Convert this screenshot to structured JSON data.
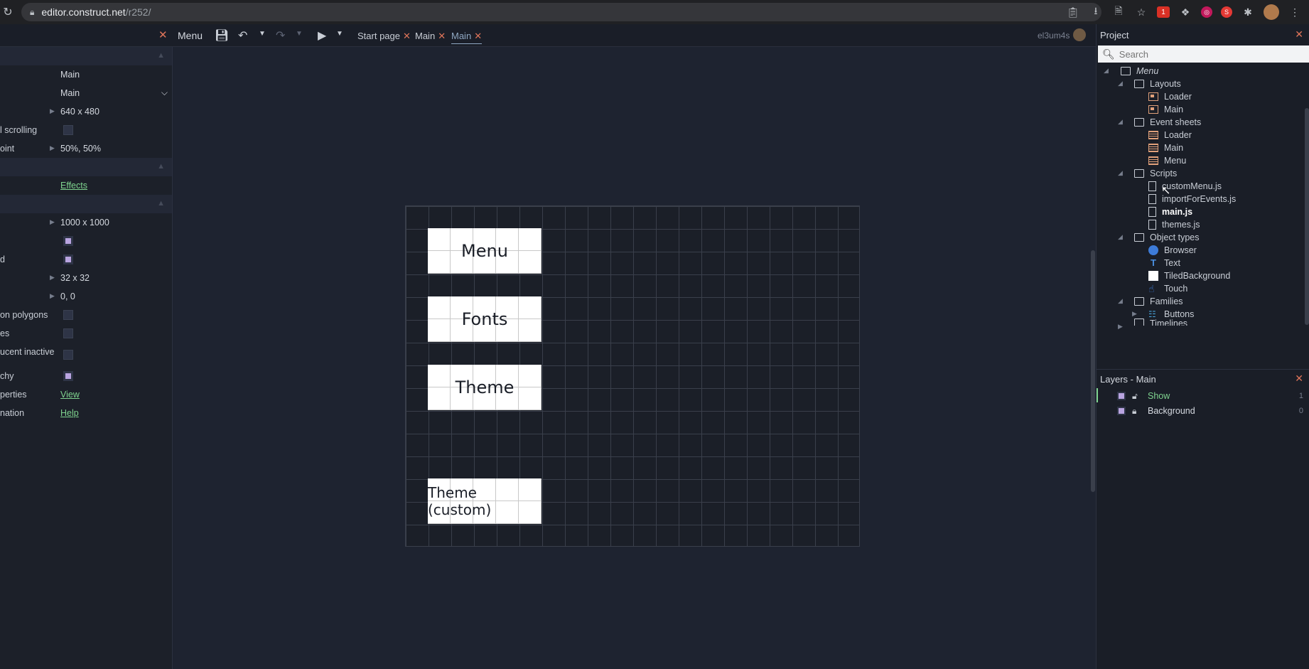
{
  "browser": {
    "url_host": "editor.construct.net",
    "url_path": "/r252/",
    "ext_badge": "1"
  },
  "toolbar": {
    "menu_label": "Menu",
    "tabs": [
      {
        "label": "Start page",
        "active": false
      },
      {
        "label": "Main",
        "active": false
      },
      {
        "label": "Main",
        "active": true
      }
    ],
    "user": "el3um4s"
  },
  "properties": {
    "rows": [
      {
        "label": "",
        "value": "Main"
      },
      {
        "label": "",
        "value": "Main"
      },
      {
        "label": "",
        "value": "640 x 480"
      },
      {
        "label": "l scrolling",
        "value": ""
      },
      {
        "label": "oint",
        "value": "50%, 50%"
      },
      {
        "label": "",
        "value": "Effects"
      },
      {
        "label": "",
        "value": "1000 x 1000"
      },
      {
        "label": "",
        "value": ""
      },
      {
        "label": "d",
        "value": ""
      },
      {
        "label": "",
        "value": "32 x 32"
      },
      {
        "label": "",
        "value": "0, 0"
      },
      {
        "label": "on polygons",
        "value": ""
      },
      {
        "label": "es",
        "value": ""
      },
      {
        "label": "ucent inactive",
        "value": ""
      },
      {
        "label": "chy",
        "value": ""
      },
      {
        "label": "perties",
        "value": "View"
      },
      {
        "label": "nation",
        "value": "Help"
      }
    ]
  },
  "layout_objects": {
    "buttons": [
      "Menu",
      "Fonts",
      "Theme",
      "Theme (custom)"
    ]
  },
  "project": {
    "title": "Project",
    "search_placeholder": "Search",
    "root": "Menu",
    "layouts_folder": "Layouts",
    "layouts": [
      "Loader",
      "Main"
    ],
    "eventsheets_folder": "Event sheets",
    "eventsheets": [
      "Loader",
      "Main",
      "Menu"
    ],
    "scripts_folder": "Scripts",
    "scripts": [
      "customMenu.js",
      "importForEvents.js",
      "main.js",
      "themes.js"
    ],
    "objecttypes_folder": "Object types",
    "objecttypes": [
      "Browser",
      "Text",
      "TiledBackground",
      "Touch"
    ],
    "families_folder": "Families",
    "families": [
      "Buttons"
    ],
    "timelines_folder": "Timelines"
  },
  "layers": {
    "title": "Layers - Main",
    "items": [
      {
        "name": "Show",
        "index": "1"
      },
      {
        "name": "Background",
        "index": "0"
      }
    ]
  },
  "colors": {
    "accent_green": "#7fd48f",
    "close_orange": "#e0755a",
    "checkbox_purple": "#b9a4e0"
  }
}
